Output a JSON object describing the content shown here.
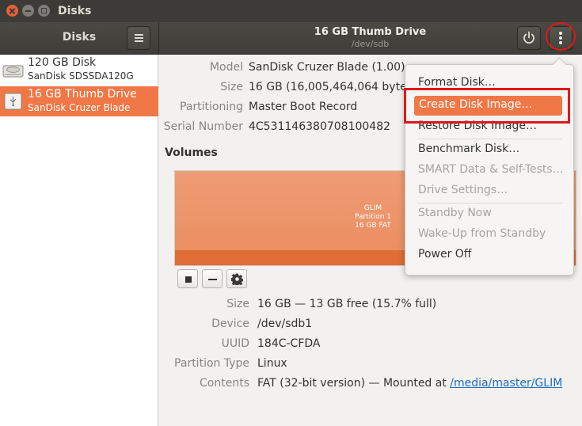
{
  "window": {
    "title": "Disks"
  },
  "header": {
    "sidebar_title": "Disks",
    "drive_title": "16 GB Thumb Drive",
    "drive_subtitle": "/dev/sdb"
  },
  "sidebar": {
    "items": [
      {
        "name": "120 GB Disk",
        "model": "SanDisk SDSSDA120G",
        "icon": "hard-disk-icon",
        "selected": false
      },
      {
        "name": "16 GB Thumb Drive",
        "model": "SanDisk Cruzer Blade",
        "icon": "usb-drive-icon",
        "selected": true
      }
    ]
  },
  "drive": {
    "model_label": "Model",
    "model": "SanDisk Cruzer Blade (1.00)",
    "size_label": "Size",
    "size": "16 GB (16,005,464,064 bytes)",
    "partitioning_label": "Partitioning",
    "partitioning": "Master Boot Record",
    "serial_label": "Serial Number",
    "serial": "4C531146380708100482"
  },
  "volumes": {
    "heading": "Volumes",
    "partition": {
      "name": "GLIM",
      "number": "Partition 1",
      "size": "16 GB FAT",
      "used_fraction": 0.157
    },
    "details": {
      "size_label": "Size",
      "size": "16 GB — 13 GB free (15.7% full)",
      "device_label": "Device",
      "device": "/dev/sdb1",
      "uuid_label": "UUID",
      "uuid": "184C-CFDA",
      "type_label": "Partition Type",
      "type": "Linux",
      "contents_label": "Contents",
      "contents": "FAT (32-bit version) — Mounted at ",
      "mount_point": "/media/master/GLIM"
    }
  },
  "menu": {
    "items": [
      {
        "label": "Format Disk…",
        "enabled": true
      },
      {
        "label": "Create Disk Image…",
        "enabled": true,
        "highlighted": true
      },
      {
        "label": "Restore Disk Image…",
        "enabled": true
      },
      {
        "label": "Benchmark Disk…",
        "enabled": true
      },
      {
        "label": "SMART Data & Self-Tests…",
        "enabled": false
      },
      {
        "label": "Drive Settings…",
        "enabled": false
      },
      {
        "label": "Standby Now",
        "enabled": false
      },
      {
        "label": "Wake-Up from Standby",
        "enabled": false
      },
      {
        "label": "Power Off",
        "enabled": true
      }
    ]
  },
  "colors": {
    "accent": "#f07746",
    "highlight_annotation": "#e01818",
    "header": "#3c3b37"
  }
}
